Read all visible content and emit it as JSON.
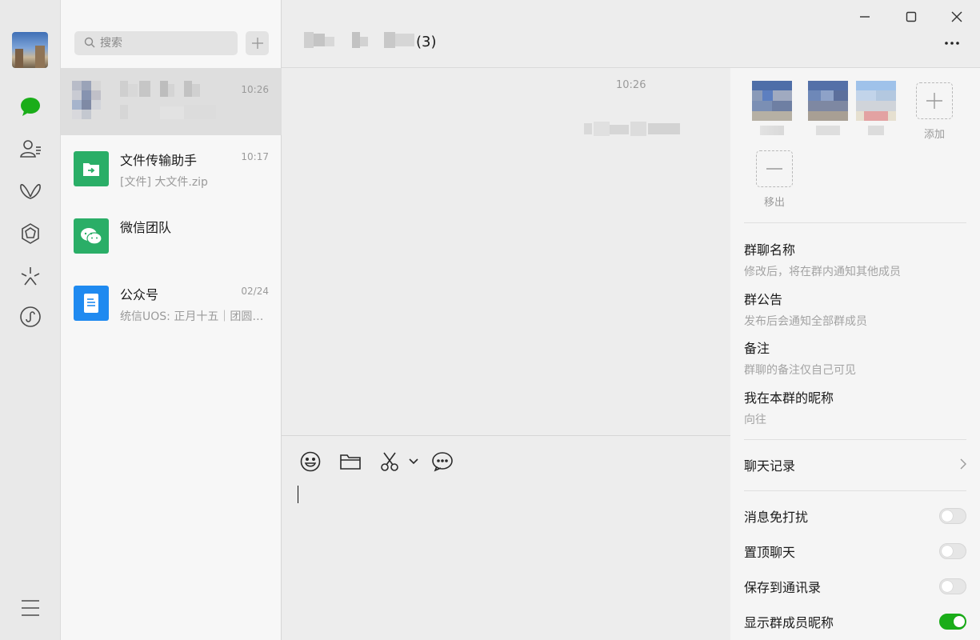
{
  "nav": {
    "items": [
      {
        "icon": "chat-bubble-icon",
        "active": true
      },
      {
        "icon": "contacts-icon"
      },
      {
        "icon": "butterfly-icon"
      },
      {
        "icon": "hexagon-star-icon"
      },
      {
        "icon": "sparkle-icon"
      },
      {
        "icon": "mini-program-icon"
      }
    ],
    "menu_icon": "hamburger-menu-icon",
    "accent": "#1aad19"
  },
  "search": {
    "placeholder": "搜索"
  },
  "conversations": [
    {
      "name": "",
      "time": "10:26",
      "preview": "",
      "active": true
    },
    {
      "name": "文件传输助手",
      "time": "10:17",
      "preview": "[文件] 大文件.zip",
      "icon_color": "#2aae67"
    },
    {
      "name": "微信团队",
      "time": "",
      "preview": "",
      "icon_color": "#2aae67"
    },
    {
      "name": "公众号",
      "time": "02/24",
      "preview": "统信UOS: 正月十五｜团圆…",
      "icon_color": "#1f8af0"
    }
  ],
  "chat": {
    "title_count": "(3)",
    "message_time": "10:26"
  },
  "composer_tools": [
    "emoji-icon",
    "folder-icon",
    "scissors-icon",
    "chevron-down-icon",
    "comment-icon"
  ],
  "group_panel": {
    "add_label": "添加",
    "remove_label": "移出",
    "settings": [
      {
        "title": "群聊名称",
        "subtitle": "修改后，将在群内通知其他成员"
      },
      {
        "title": "群公告",
        "subtitle": "发布后会通知全部群成员"
      },
      {
        "title": "备注",
        "subtitle": "群聊的备注仅自己可见"
      },
      {
        "title": "我在本群的昵称",
        "subtitle": "向往"
      }
    ],
    "chat_history": "聊天记录",
    "toggles": [
      {
        "label": "消息免打扰",
        "on": false
      },
      {
        "label": "置顶聊天",
        "on": false
      },
      {
        "label": "保存到通讯录",
        "on": false
      },
      {
        "label": "显示群成员昵称",
        "on": true
      }
    ]
  }
}
